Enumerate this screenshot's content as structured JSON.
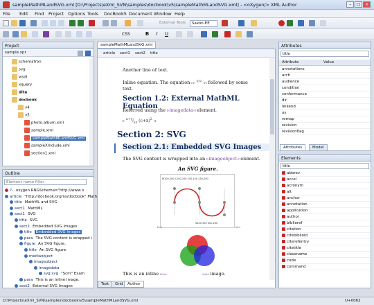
{
  "window": {
    "title": "sampleMathMLandSVG.xml [D:\\Projects\\eXml_SVN\\samples\\docbook\\v5\\sampleMathMLandSVG.xml] - <oXygen/> XML Author"
  },
  "menu": [
    "File",
    "Edit",
    "Find",
    "Project",
    "Options",
    "Tools",
    "DocBook5",
    "Document",
    "Window",
    "Help"
  ],
  "toolbar": {
    "external_tools": "External Tools",
    "saxon": "Saxon-EE",
    "css": "CSS"
  },
  "project": {
    "title": "Project",
    "root": "sample.xpr",
    "items": [
      "schematron",
      "svg",
      "wsdl",
      "xquery",
      "dita",
      "docbook",
      "v4",
      "v5",
      "photo-album.xml",
      "sample.xml",
      "sampleMathMLandSVG.xml",
      "sampleXInclude.xml",
      "section1.xml"
    ]
  },
  "outline": {
    "title": "Outline",
    "filter_placeholder": "Element name filter",
    "rows": [
      {
        "tag": "?-",
        "text": "oxygen RNGSchema=\"http://www.o"
      },
      {
        "tag": "article",
        "text": "\"http://docbook.org/ns/docbook\" MathM"
      },
      {
        "tag": "title",
        "text": "MathML and SVG"
      },
      {
        "tag": "sect1",
        "text": "MathML"
      },
      {
        "tag": "sect1",
        "text": "SVG"
      },
      {
        "tag": "title",
        "text": "SVG"
      },
      {
        "tag": "sect2",
        "text": "Embedded SVG Images"
      },
      {
        "tag": "title",
        "text": "Embedded SVG Images"
      },
      {
        "tag": "para",
        "text": "The SVG content is wrapped i"
      },
      {
        "tag": "figure",
        "text": "An SVG figure."
      },
      {
        "tag": "title",
        "text": "An SVG figure."
      },
      {
        "tag": "mediaobject",
        "text": ""
      },
      {
        "tag": "imageobject",
        "text": ""
      },
      {
        "tag": "imagedata",
        "text": ""
      },
      {
        "tag": "svg:svg",
        "text": "\"Scm\" Exam"
      },
      {
        "tag": "para",
        "text": "This is an inline image."
      },
      {
        "tag": "sect2",
        "text": "External SVG Images"
      }
    ]
  },
  "editor": {
    "tab": "sampleMathMLandSVG.xml",
    "breadcrumb": [
      "article",
      "sect1",
      "sect2",
      "title"
    ],
    "line1": "Another line of text.",
    "line2": "Inline equation. The equation",
    "line2b": "followed by some",
    "line2c": "text.",
    "h12": "Section 1.2: External MathML Equation",
    "ref": "Referred using the",
    "ref_tag": "imagedata",
    "ref_end": "element.",
    "h2": "Section 2: SVG",
    "h21": "Section 2.1: Embedded SVG Images",
    "wrap": "The SVG content is wrapped into an",
    "wrap_tag": "imageobject",
    "wrap_end": "element.",
    "fig_title": "An SVG figure.",
    "inline": "This is an inline",
    "inline_end": "image.",
    "svg_label1": "M100,200 C100,100 250,100 250,200",
    "svg_label2": "S400,300 400,200",
    "bottom_tabs": [
      "Text",
      "Grid",
      "Author"
    ]
  },
  "attributes": {
    "title": "Attributes",
    "element": "title",
    "col_attr": "Attribute",
    "col_val": "Value",
    "items": [
      "annotations",
      "arch",
      "audience",
      "condition",
      "conformance",
      "dir",
      "linkend",
      "os",
      "remap",
      "revision",
      "revisionflag"
    ]
  },
  "right_tabs": [
    "Attributes",
    "Model"
  ],
  "elements": {
    "title": "Elements",
    "context": "title",
    "items": [
      "abbrev",
      "accel",
      "acronym",
      "alt",
      "anchor",
      "annotation",
      "application",
      "author",
      "biblioref",
      "citation",
      "citebiblioid",
      "citerefentry",
      "citetitle",
      "classname",
      "code",
      "command"
    ]
  },
  "status": {
    "path": "D:\\Projects\\eXml_SVN\\samples\\docbook\\v5\\sampleMathMLandSVG.xml",
    "code": "U+0062"
  },
  "colors": {
    "accent": "#3b6fb6",
    "heading": "#0f2a5a",
    "tag": "#7a3f9c"
  }
}
